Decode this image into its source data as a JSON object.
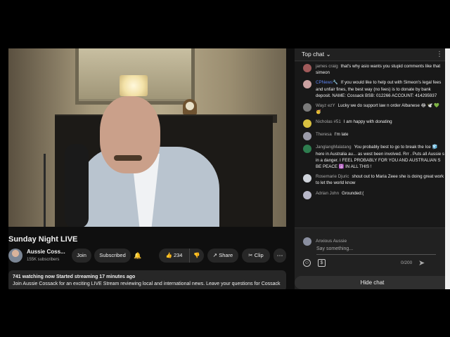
{
  "video": {
    "title": "Sunday Night LIVE"
  },
  "channel": {
    "name": "Aussie Coss...",
    "subscribers": "155K subscribers",
    "join_label": "Join",
    "subscribed_label": "Subscribed"
  },
  "actions": {
    "likes": "234",
    "share_label": "Share",
    "clip_label": "Clip"
  },
  "description": {
    "stats": "741 watching now  Started streaming 17 minutes ago",
    "text": "Join Aussie Cossack for an exciting LIVE Stream reviewing local and international news. Leave your questions for Cossack"
  },
  "chat": {
    "header": "Top chat",
    "messages": [
      {
        "author": "james craig",
        "text": "that's why asio wants you stupid comments like that simeon",
        "avatar_color": "#a05a5a",
        "mod": false
      },
      {
        "author": "CPNews🔧",
        "text": "If you would like to help out with Simeon's legal fees and unfair fines, the best way (no fees) is to donate by bank deposit. NAME: Cossack BSB: 012266 ACCOUNT: 414295937",
        "avatar_color": "#c9a0a0",
        "mod": true
      },
      {
        "author": "Wayz ezY",
        "text": "Lucky we do support law n order Albanese 😂 🕊️ 💚 🥳",
        "avatar_color": "#7a7a7a",
        "mod": false
      },
      {
        "author": "Nicholas #51",
        "text": "I am happy with donating",
        "avatar_color": "#d8c040",
        "mod": false
      },
      {
        "author": "Theresa",
        "text": "I'm late",
        "avatar_color": "#9a9aa8",
        "mod": false
      },
      {
        "author": "JanglangMalatang",
        "text": "You probably best to go to break the Ice 🧊 here in Australia au... as west been involved. Rrr . Puts all Aussie s in a danger. I FEEL PROBABLY FOR YOU AND AUSTRALIAN S BE PEACE ☮️ IN ALL THIS !",
        "avatar_color": "#2e7d4f",
        "mod": false
      },
      {
        "author": "Rosemarie Djuric",
        "text": "shout out to Maria Zeee she is doing great work to let the world know",
        "avatar_color": "#cfd3da",
        "mod": false
      },
      {
        "author": "Adrian John",
        "text": "Grounded:(",
        "avatar_color": "#b8b8c8",
        "mod": false
      }
    ],
    "current_user": "Anxious Aussie",
    "placeholder": "Say something...",
    "char_count": "0/200",
    "hide_label": "Hide chat"
  }
}
